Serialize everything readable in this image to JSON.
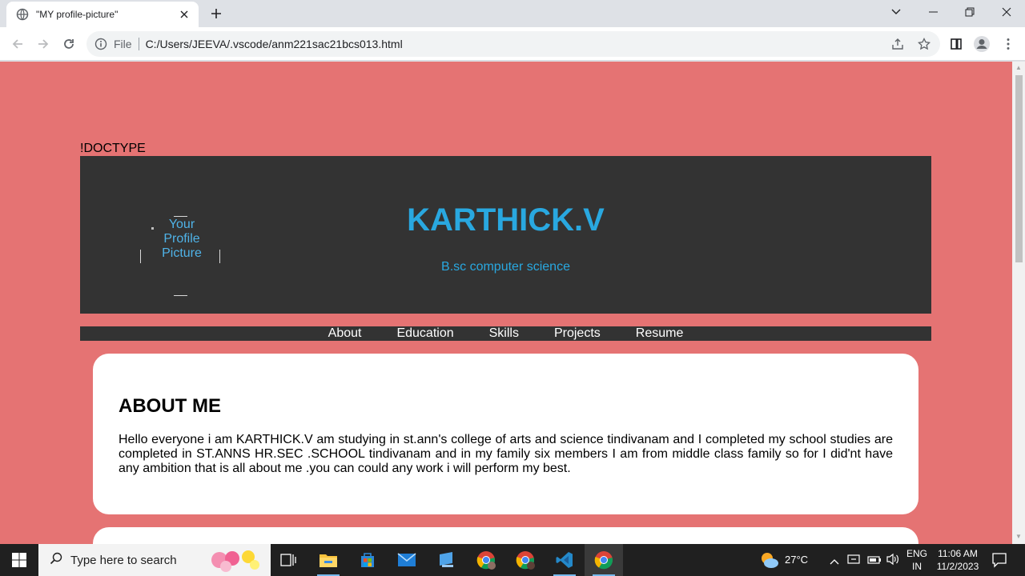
{
  "browser": {
    "tab_title": "\"MY profile-picture\"",
    "omnibox_scheme": "File",
    "url": "C:/Users/JEEVA/.vscode/anm221sac21bcs013.html"
  },
  "page": {
    "doctype_text": "!DOCTYPE",
    "profile_picture_text": "Your Profile Picture",
    "name": "KARTHICK.V",
    "degree": "B.sc computer science",
    "nav": [
      "About",
      "Education",
      "Skills",
      "Projects",
      "Resume"
    ],
    "about": {
      "heading": "ABOUT ME",
      "body": "Hello everyone i am KARTHICK.V am studying in st.ann's college of arts and science tindivanam and I completed my school studies are completed in ST.ANNS HR.SEC .SCHOOL tindivanam and in my family six members I am from middle class family so for I did'nt have any ambition that is all about me .you can could any work i will perform my best."
    },
    "colors": {
      "background": "#e57373",
      "header_bg": "#333333",
      "accent": "#29a8e0"
    }
  },
  "taskbar": {
    "search_placeholder": "Type here to search",
    "weather": "27°C",
    "lang_top": "ENG",
    "lang_bottom": "IN",
    "time": "11:06 AM",
    "date": "11/2/2023"
  }
}
